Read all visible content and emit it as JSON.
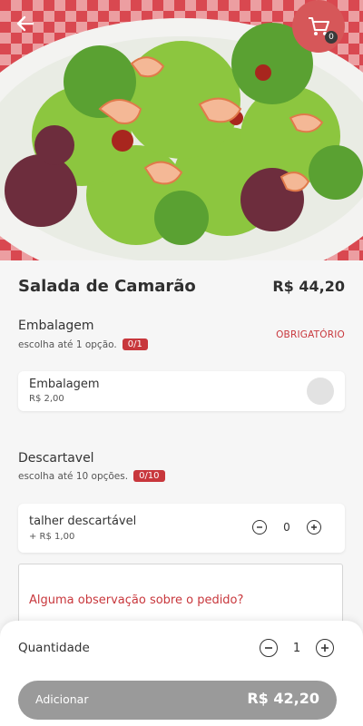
{
  "header": {
    "back_icon": "arrow-left-icon",
    "cart_icon": "cart-icon",
    "cart_count": "0",
    "colors": {
      "cart_bg": "#d65759"
    }
  },
  "product": {
    "name": "Salada de Camarão",
    "price": "R$ 44,20"
  },
  "groups": [
    {
      "title": "Embalagem",
      "hint": "escolha até 1 opção.",
      "counter": "0/1",
      "required_label": "OBRIGATÓRIO",
      "options": [
        {
          "name": "Embalagem",
          "price": "R$ 2,00"
        }
      ]
    },
    {
      "title": "Descartavel",
      "hint": "escolha até 10 opções.",
      "counter": "0/10",
      "options": [
        {
          "name": "talher descartável",
          "price": "+ R$ 1,00",
          "quantity": "0"
        }
      ]
    }
  ],
  "observation": {
    "placeholder": "Alguma observação sobre o pedido?"
  },
  "footer": {
    "quantity_label": "Quantidade",
    "quantity_value": "1",
    "add_label": "Adicionar",
    "add_total": "R$ 42,20"
  },
  "colors": {
    "accent": "#c8373c",
    "button_disabled": "#9a9a9a"
  }
}
